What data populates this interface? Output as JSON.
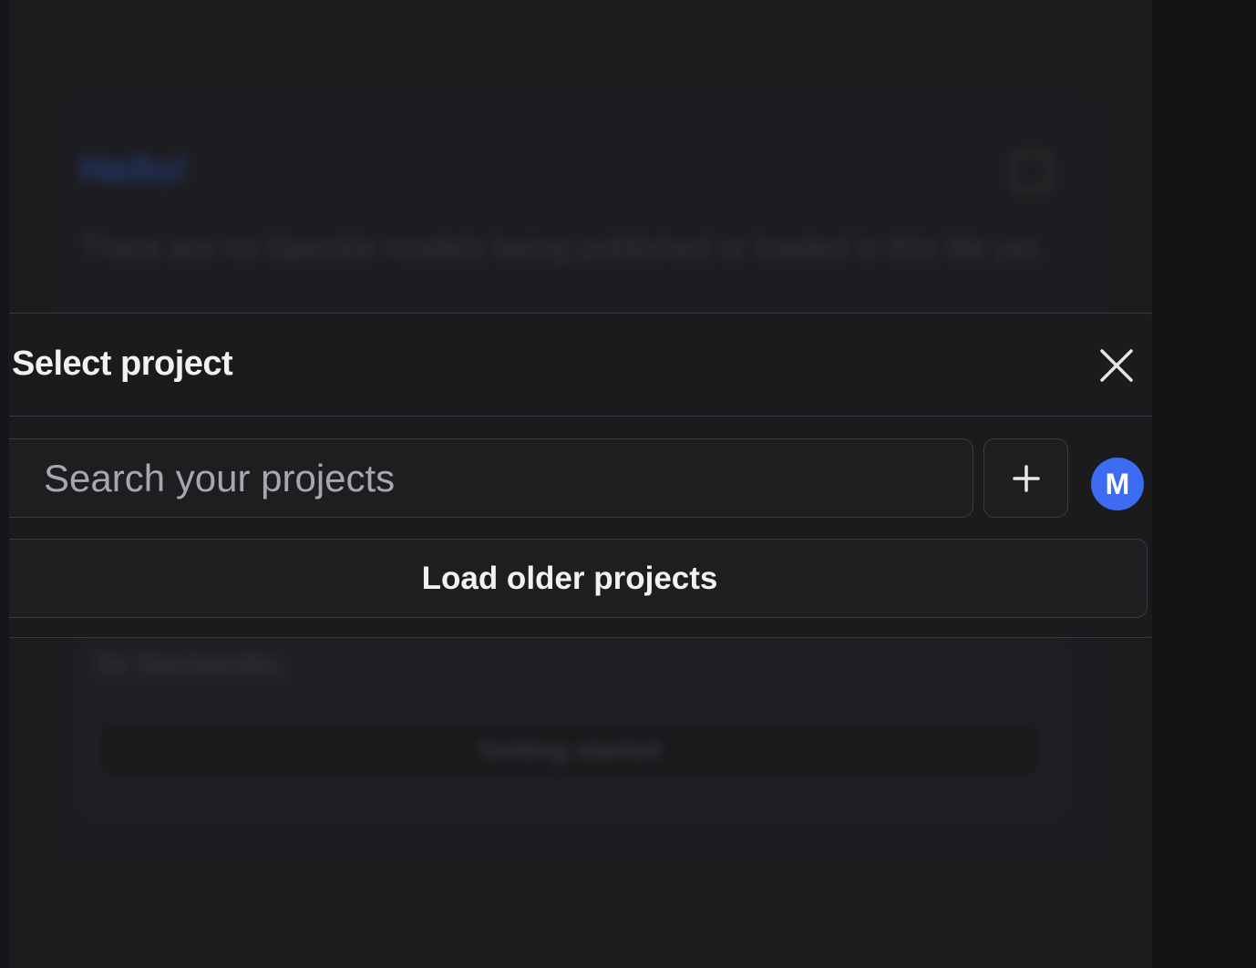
{
  "background": {
    "greeting": "Hello!",
    "description": "There are no Speckle models being published or loaded in this file yet.",
    "card_text": "for Navisworks.",
    "getting_started_label": "Getting started"
  },
  "dialog": {
    "title": "Select project",
    "search_placeholder": "Search your projects",
    "search_value": "",
    "add_label": "+",
    "avatar_initial": "M",
    "load_older_label": "Load older projects"
  },
  "colors": {
    "accent": "#3d6cf3",
    "panel_bg": "#1c1c1f",
    "dialog_bg": "#1b1b1e",
    "border": "#3a3a40"
  },
  "icons": {
    "close": "close-icon",
    "add": "plus-icon",
    "edit": "edit-icon"
  }
}
